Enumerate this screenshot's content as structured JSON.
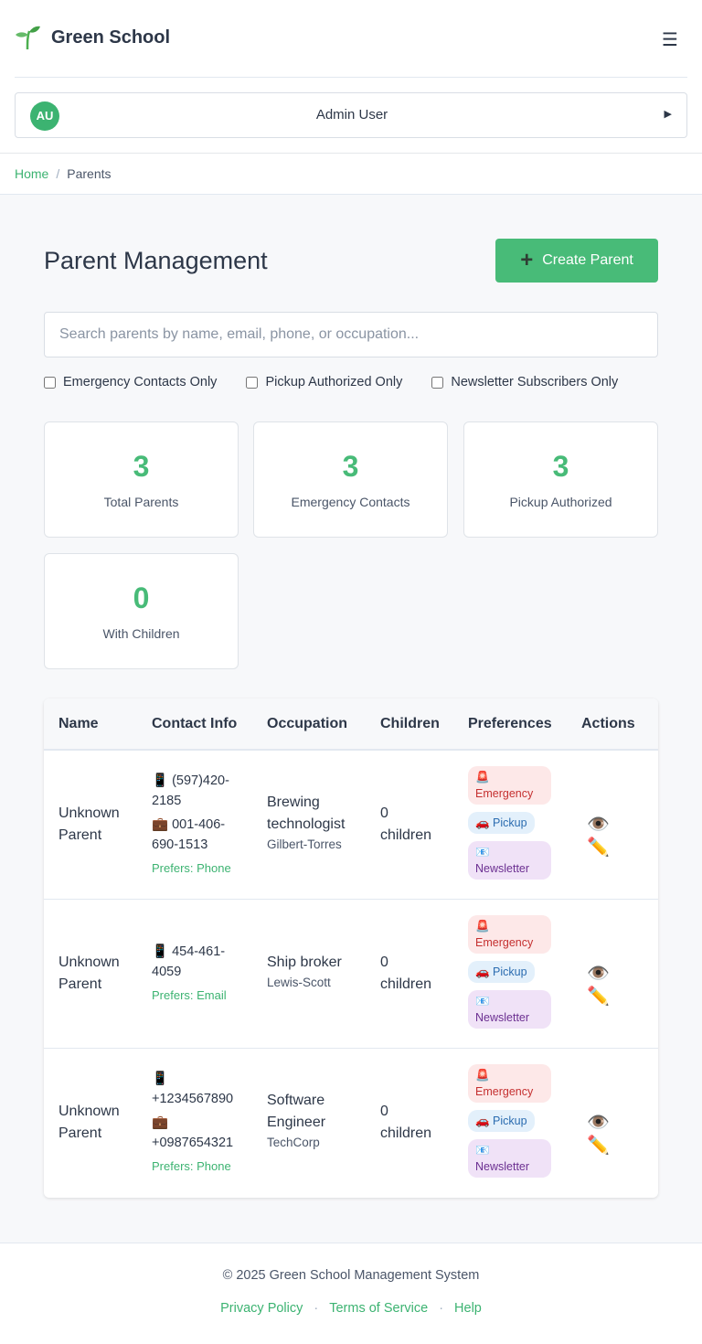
{
  "app": {
    "title": "Green School"
  },
  "user": {
    "initials": "AU",
    "name": "Admin User"
  },
  "breadcrumb": {
    "home": "Home",
    "current": "Parents"
  },
  "page": {
    "title": "Parent Management",
    "create_label": "Create Parent",
    "search_placeholder": "Search parents by name, email, phone, or occupation...",
    "filters": [
      "Emergency Contacts Only",
      "Pickup Authorized Only",
      "Newsletter Subscribers Only"
    ]
  },
  "stats": [
    {
      "value": "3",
      "label": "Total Parents"
    },
    {
      "value": "3",
      "label": "Emergency Contacts"
    },
    {
      "value": "3",
      "label": "Pickup Authorized"
    },
    {
      "value": "0",
      "label": "With Children"
    }
  ],
  "table": {
    "headers": [
      "Name",
      "Contact Info",
      "Occupation",
      "Children",
      "Preferences",
      "Actions"
    ],
    "rows": [
      {
        "name1": "Unknown",
        "name2": "Parent",
        "phone1": "📱 (597)420-2185",
        "phone2": "💼 001-406-690-1513",
        "prefers": "Prefers: Phone",
        "job": "Brewing technologist",
        "employer": "Gilbert-Torres",
        "children1": "0",
        "children2": "children"
      },
      {
        "name1": "Unknown",
        "name2": "Parent",
        "phone1": "📱 454-461-4059",
        "phone2": "",
        "prefers": "Prefers: Email",
        "job": "Ship broker",
        "employer": "Lewis-Scott",
        "children1": "0",
        "children2": "children"
      },
      {
        "name1": "Unknown",
        "name2": "Parent",
        "phone1": "📱 +1234567890",
        "phone2": "💼 +0987654321",
        "prefers": "Prefers: Phone",
        "job": "Software Engineer",
        "employer": "TechCorp",
        "children1": "0",
        "children2": "children"
      }
    ],
    "badges": {
      "emergency": "🚨 Emergency",
      "pickup": "🚗 Pickup",
      "newsletter": "📧 Newsletter"
    },
    "actions": {
      "view": "👁️",
      "edit": "✏️"
    }
  },
  "footer": {
    "copyright": "© 2025 Green School Management System",
    "links": [
      "Privacy Policy",
      "Terms of Service",
      "Help"
    ],
    "separator": "·"
  },
  "colors": {
    "accent": "#48bb78",
    "brand_text": "#2d3748"
  }
}
